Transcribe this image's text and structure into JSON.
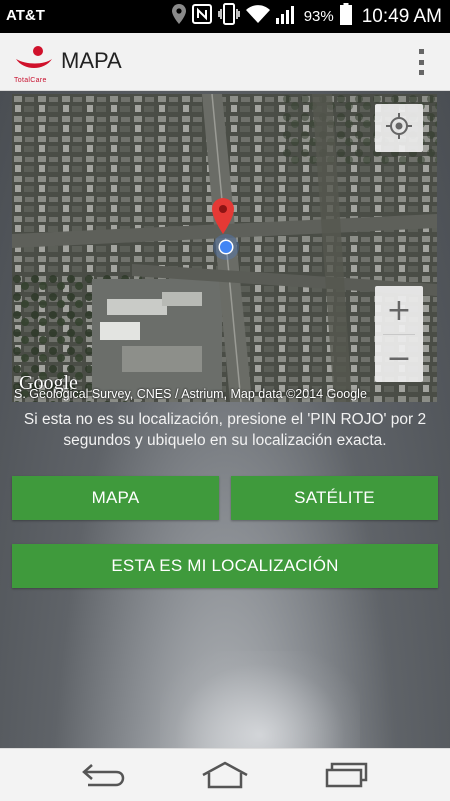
{
  "status_bar": {
    "carrier": "AT&T",
    "battery": "93%",
    "time": "10:49 AM",
    "icons": [
      "location-icon",
      "nfc-icon",
      "vibrate-icon",
      "wifi-icon",
      "signal-icon",
      "battery-icon"
    ]
  },
  "app_bar": {
    "logo_text": "TotalCare",
    "title": "MAPA",
    "overflow_icon": "overflow-menu-icon"
  },
  "map": {
    "google_logo": "Google",
    "attribution": "S. Geological Survey, CNES / Astrium, Map data ©2014 Google",
    "zoom_in": "+",
    "zoom_out": "−",
    "colors": {
      "pin": "#e53935",
      "my_location": "#4285f4"
    }
  },
  "instructions": "Si esta no es su localización, presione el 'PIN ROJO' por 2 segundos y ubiquelo en su localización exacta.",
  "buttons": {
    "map": "MAPA",
    "satellite": "SATÉLITE",
    "confirm": "ESTA ES MI LOCALIZACIÓN",
    "color": "#3f9a3c"
  },
  "nav_bar": {
    "icons": [
      "back-icon",
      "home-icon",
      "recent-apps-icon"
    ]
  }
}
